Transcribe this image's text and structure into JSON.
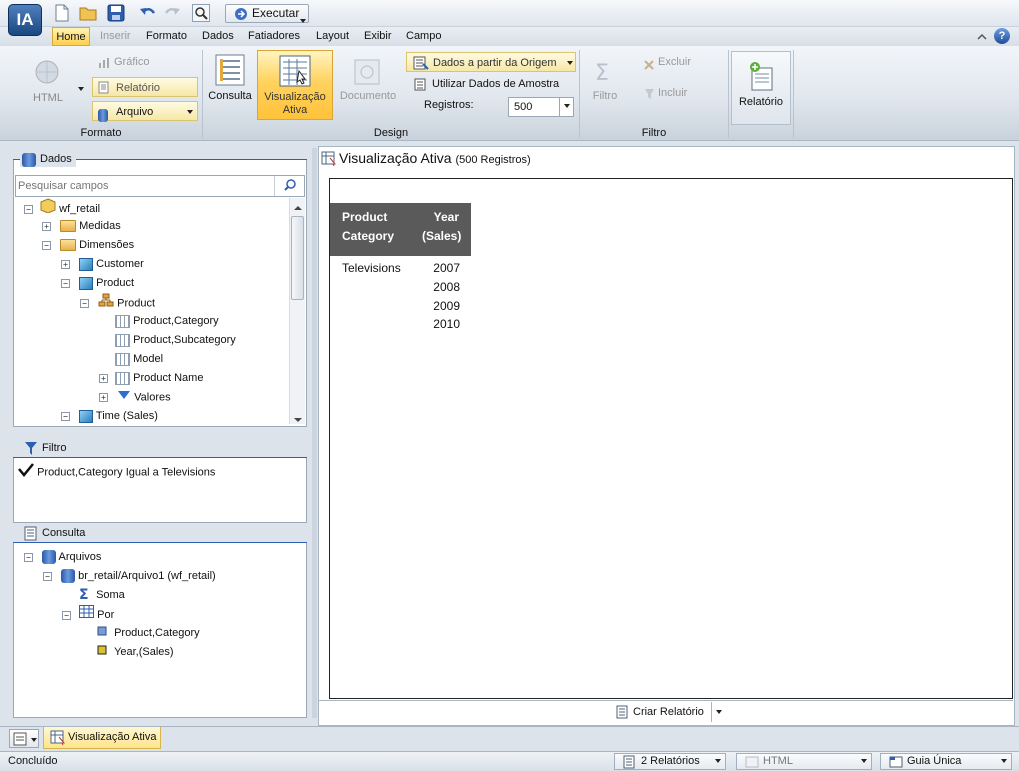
{
  "app": {
    "logo_text": "IA"
  },
  "quick_access": {
    "run_label": "Executar"
  },
  "menu": [
    "Home",
    "Inserir",
    "Formato",
    "Dados",
    "Fatiadores",
    "Layout",
    "Exibir",
    "Campo"
  ],
  "ribbon": {
    "format": {
      "html_label": "HTML",
      "chart_label": "Gráfico",
      "report_label": "Relatório",
      "file_label": "Arquivo",
      "group_label": "Formato"
    },
    "design": {
      "query_label": "Consulta",
      "active_view_line1": "Visualização",
      "active_view_line2": "Ativa",
      "document_label": "Documento",
      "source_data_label": "Dados a partir da Origem",
      "sample_data_label": "Utilizar Dados de Amostra",
      "records_label": "Registros:",
      "records_value": "500",
      "group_label": "Design"
    },
    "filter": {
      "filter_label": "Filtro",
      "exclude_label": "Excluir",
      "include_label": "Incluir",
      "group_label": "Filtro"
    },
    "report": {
      "report_label": "Relatório"
    }
  },
  "data_panel": {
    "title": "Dados",
    "search_placeholder": "Pesquisar campos",
    "tree": {
      "root": "wf_retail",
      "measures": "Medidas",
      "dimensions": "Dimensões",
      "customer": "Customer",
      "product_dim": "Product",
      "product_hier": "Product",
      "product_category": "Product,Category",
      "product_subcategory": "Product,Subcategory",
      "model": "Model",
      "product_name": "Product Name",
      "values": "Valores",
      "time_sales": "Time (Sales)"
    }
  },
  "filter_panel": {
    "title": "Filtro",
    "condition": "Product,Category Igual a Televisions"
  },
  "query_panel": {
    "title": "Consulta",
    "tree": {
      "files": "Arquivos",
      "file": "br_retail/Arquivo1 (wf_retail)",
      "sum": "Soma",
      "by": "Por",
      "by_field1": "Product,Category",
      "by_field2": "Year,(Sales)"
    }
  },
  "canvas": {
    "title": "Visualização Ativa",
    "records_note": "(500 Registros)",
    "report": {
      "col1_header_line1": "Product",
      "col1_header_line2": "Category",
      "col2_header_line1": "Year",
      "col2_header_line2": "(Sales)",
      "category": "Televisions",
      "years": [
        "2007",
        "2008",
        "2009",
        "2010"
      ]
    },
    "create_report_label": "Criar Relatório"
  },
  "bottom_tab": {
    "label": "Visualização Ativa"
  },
  "status": {
    "text": "Concluído",
    "reports": "2 Relatórios",
    "format": "HTML",
    "layout": "Guia Única"
  },
  "colors": {
    "accent": "#ffcf4c",
    "report_header": "#5a5a5a",
    "brand": "#1c4780"
  }
}
